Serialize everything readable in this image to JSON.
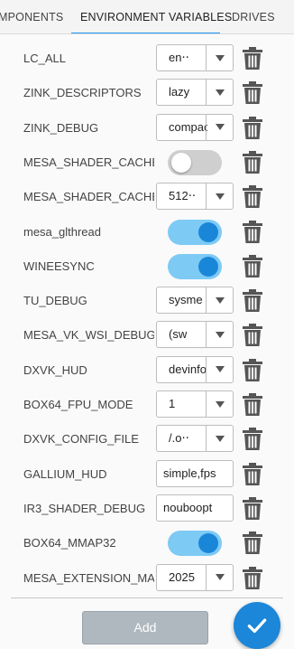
{
  "tabs": [
    {
      "label": "MPONENTS"
    },
    {
      "label": "ENVIRONMENT VARIABLES"
    },
    {
      "label": "DRIVES"
    }
  ],
  "colors": {
    "accent": "#2196f3",
    "toggle_on": "#7dcaf5",
    "knob_on": "#1a86d8",
    "fab": "#1c86d8"
  },
  "env_vars": [
    {
      "name": "LC_ALL",
      "kind": "select",
      "value": "en‧‧"
    },
    {
      "name": "ZINK_DESCRIPTORS",
      "kind": "select",
      "value": "lazy"
    },
    {
      "name": "ZINK_DEBUG",
      "kind": "select",
      "value": "compac"
    },
    {
      "name": "MESA_SHADER_CACHE",
      "kind": "toggle",
      "value": "off"
    },
    {
      "name": "MESA_SHADER_CACHE",
      "kind": "select",
      "value": "512‧‧"
    },
    {
      "name": "mesa_glthread",
      "kind": "toggle",
      "value": "on"
    },
    {
      "name": "WINEESYNC",
      "kind": "toggle",
      "value": "on"
    },
    {
      "name": "TU_DEBUG",
      "kind": "select",
      "value": "sysme"
    },
    {
      "name": "MESA_VK_WSI_DEBUG",
      "kind": "select",
      "value": "(sw"
    },
    {
      "name": "DXVK_HUD",
      "kind": "select",
      "value": "devinfo"
    },
    {
      "name": "BOX64_FPU_MODE",
      "kind": "select",
      "value": "1"
    },
    {
      "name": "DXVK_CONFIG_FILE",
      "kind": "select",
      "value": "/.o‧‧"
    },
    {
      "name": "GALLIUM_HUD",
      "kind": "text",
      "value": "simple,fps"
    },
    {
      "name": "IR3_SHADER_DEBUG",
      "kind": "text",
      "value": "nouboopt"
    },
    {
      "name": "BOX64_MMAP32",
      "kind": "toggle",
      "value": "on"
    },
    {
      "name": "MESA_EXTENSION_MA",
      "kind": "select",
      "value": "2025"
    }
  ],
  "footer": {
    "add_label": "Add",
    "confirm_icon": "check-icon",
    "delete_icon": "trash-icon"
  }
}
